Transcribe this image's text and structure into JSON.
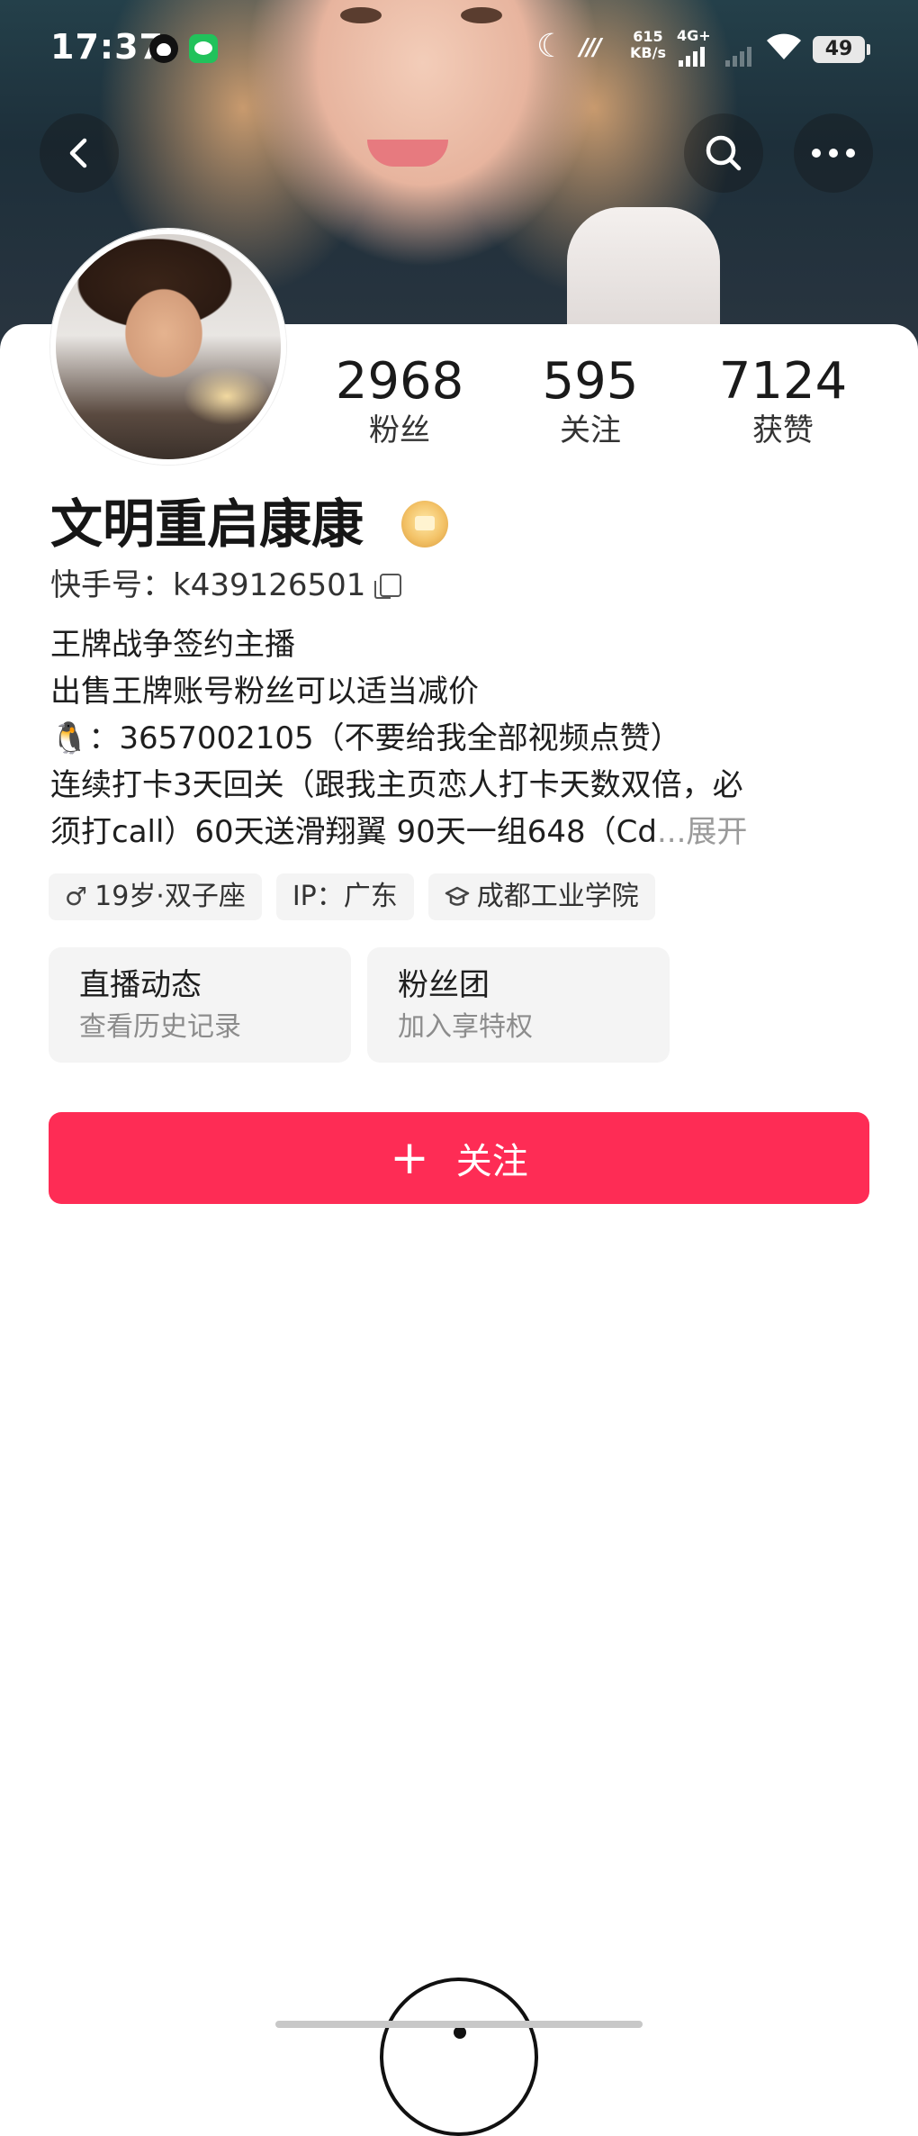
{
  "status_bar": {
    "time": "17:37",
    "speed_value": "615",
    "speed_unit": "KB/s",
    "network": "4G+",
    "battery": "49",
    "icons": [
      "qq-icon",
      "wechat-icon",
      "moon-icon",
      "hd-icon",
      "signal-icon",
      "wifi-icon",
      "battery-icon"
    ]
  },
  "nav": {
    "back_icon": "chevron-left-icon",
    "search_icon": "search-icon",
    "more_icon": "more-icon"
  },
  "profile": {
    "name": "文明重启康康",
    "kuaishou_id": "快手号：k439126501",
    "stats": [
      {
        "num": "2968",
        "label": "粉丝"
      },
      {
        "num": "595",
        "label": "关注"
      },
      {
        "num": "7124",
        "label": "获赞"
      }
    ],
    "bio": [
      "王牌战争签约主播",
      "出售王牌账号粉丝可以适当减价",
      "🐧：3657002105（不要给我全部视频点赞）",
      "连续打卡3天回关（跟我主页恋人打卡天数双倍，必",
      "须打call）60天送滑翔翼 90天一组648（Cd"
    ],
    "bio_ellipsis": "...",
    "bio_expand": "展开",
    "tags": [
      {
        "icon": "♂",
        "text": "19岁·双子座"
      },
      {
        "icon": "",
        "text": "IP：广东"
      },
      {
        "icon": "🎓",
        "text": "成都工业学院"
      }
    ]
  },
  "features": [
    {
      "title": "直播动态",
      "subtitle": "查看历史记录"
    },
    {
      "title": "粉丝团",
      "subtitle": "加入享特权"
    }
  ],
  "follow_button": {
    "plus": "+",
    "label": "关注"
  },
  "colors": {
    "accent": "#fe2c55",
    "tag_bg": "#f4f4f4",
    "muted": "#8c8c8c"
  }
}
